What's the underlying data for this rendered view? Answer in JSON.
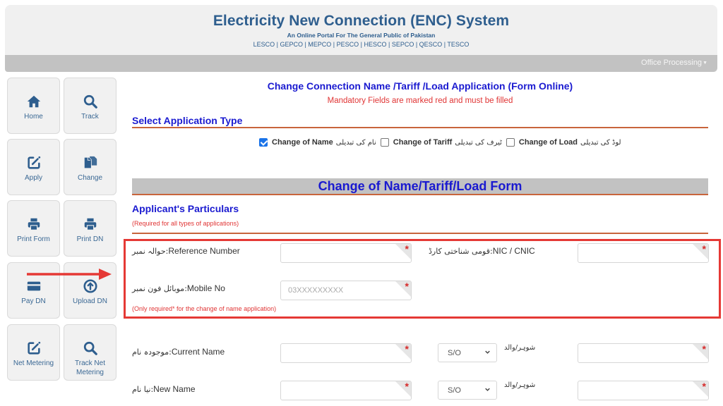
{
  "header": {
    "title": "Electricity New Connection (ENC) System",
    "subtitle": "An Online Portal For The General Public of Pakistan",
    "discos": "LESCO | GEPCO | MEPCO | PESCO | HESCO | SEPCO | QESCO | TESCO"
  },
  "navbar": {
    "office_processing": "Office Processing",
    "caret": "▼"
  },
  "sidebar": {
    "items": [
      {
        "label": "Home",
        "icon": "home-icon"
      },
      {
        "label": "Track",
        "icon": "search-icon"
      },
      {
        "label": "Apply",
        "icon": "edit-icon"
      },
      {
        "label": "Change",
        "icon": "copy-icon"
      },
      {
        "label": "Print Form",
        "icon": "printer-icon"
      },
      {
        "label": "Print DN",
        "icon": "printer-icon"
      },
      {
        "label": "Pay DN",
        "icon": "credit-card-icon"
      },
      {
        "label": "Upload DN",
        "icon": "upload-icon"
      },
      {
        "label": "Net Metering",
        "icon": "edit-icon"
      },
      {
        "label": "Track Net",
        "label2": "Metering",
        "icon": "search-icon"
      }
    ]
  },
  "main": {
    "form_title": "Change Connection Name /Tariff /Load Application (Form Online)",
    "mandatory_note": "Mandatory Fields are marked red and must be filled",
    "select_type_heading": "Select Application Type",
    "app_types": [
      {
        "label": "Change of Name",
        "urdu": "نام کی تبدیلی",
        "checked": true
      },
      {
        "label": "Change of Tariff",
        "urdu": "ٹیرف کی تبدیلی",
        "checked": false
      },
      {
        "label": "Change of Load",
        "urdu": "لوڈ کی تبدیلی",
        "checked": false
      }
    ],
    "form_banner": "Change of Name/Tariff/Load Form",
    "applicant_heading": "Applicant's Particulars",
    "applicant_note": "(Required for all types of applications)",
    "fields": {
      "reference_number": {
        "label": "Reference Number",
        "urdu": "حوالہ نمبر:",
        "value": "",
        "required": true
      },
      "cnic": {
        "label": "NIC / CNIC",
        "urdu": "قومی شناختی کارڈ:",
        "value": "",
        "required": true
      },
      "mobile_no": {
        "label": "Mobile No",
        "urdu": "موبائل فون نمبر:",
        "value": "",
        "placeholder": "03XXXXXXXXX",
        "required": true
      },
      "mobile_note": "(Only required* for the change of name application)",
      "current_name": {
        "label": "Current Name",
        "urdu": "موجودہ نام:",
        "value": "",
        "required": true
      },
      "current_relation": {
        "selected": "S/O",
        "urdu": "شوہر/والد"
      },
      "current_father_name": {
        "value": "",
        "required": true
      },
      "new_name": {
        "label": "New Name",
        "urdu": "نیا نام:",
        "value": "",
        "required": true
      },
      "new_relation": {
        "selected": "S/O",
        "urdu": "شوہر/والد"
      },
      "new_father_name": {
        "value": "",
        "required": true
      }
    },
    "required_marker": "*"
  },
  "colors": {
    "header_text": "#2e5e8e",
    "heading_blue": "#1a1ad0",
    "error_red": "#e03434",
    "rule_orange": "#c8643c",
    "highlight_red": "#e53935"
  }
}
